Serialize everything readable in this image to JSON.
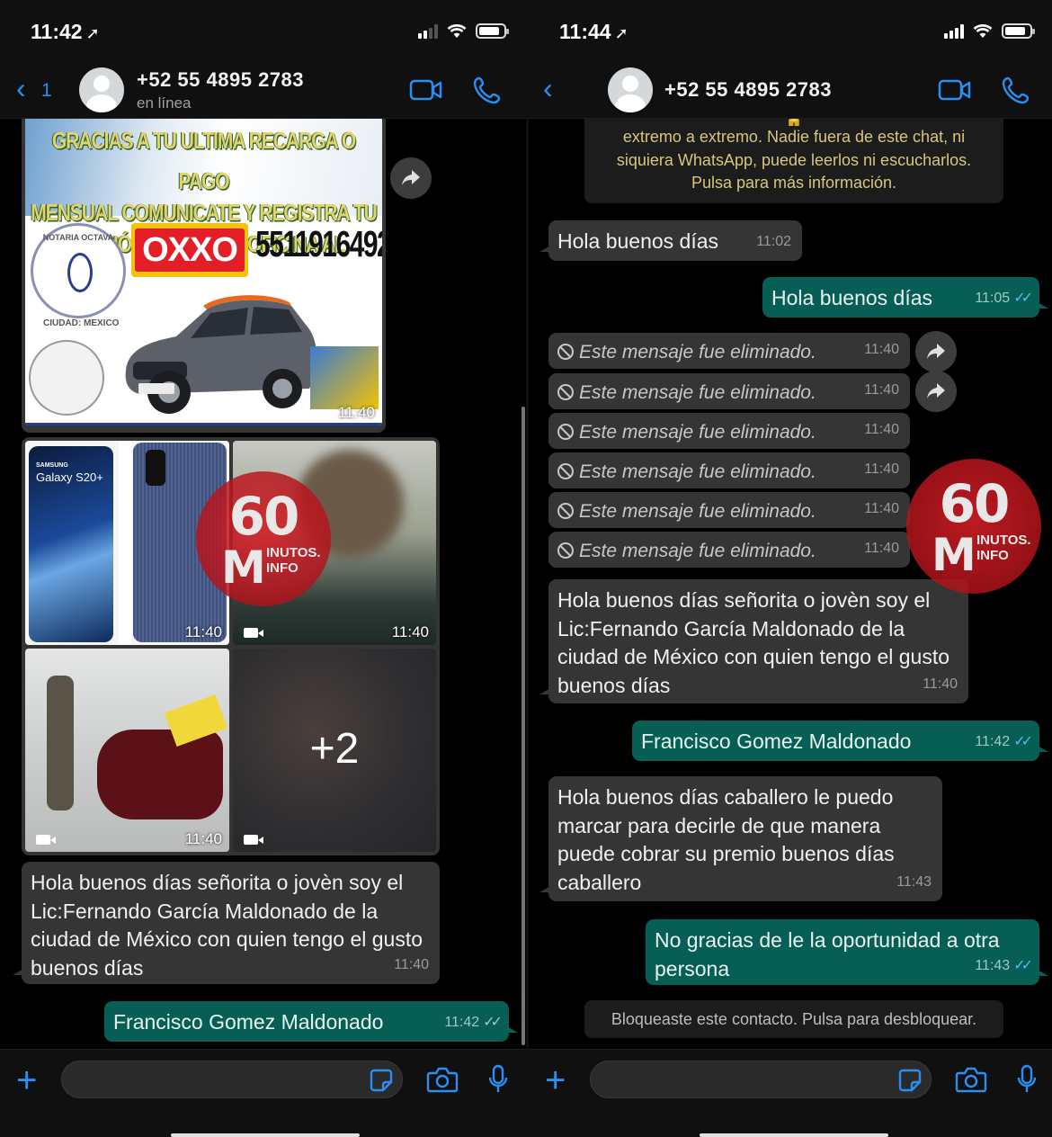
{
  "left": {
    "status": {
      "time": "11:42"
    },
    "header": {
      "back_count": "1",
      "contact_name": "+52 55 4895 2783",
      "contact_status": "en línea"
    },
    "promo_image": {
      "lines": [
        "GRACIAS A TU ULTIMA RECARGA O PAGO",
        "MENSUAL COMUNICATE Y REGISTRA TU",
        "PREMIÓ NÚMERO DE OFICINA AL"
      ],
      "brand": "OXXO",
      "phone": "5511916492",
      "seal_text": "NOTARIA OCTAVA",
      "seal_city": "CIUDAD: MEXICO",
      "time": "11:40"
    },
    "media": {
      "tile1": {
        "label_top": "SAMSUNG",
        "label": "Galaxy S20+",
        "time": "11:40"
      },
      "tile2": {
        "time": "11:40"
      },
      "tile3": {
        "time": "11:40"
      },
      "tile4": {
        "more": "+2"
      }
    },
    "messages": [
      {
        "text": "Hola buenos días señorita o jovèn soy el Lic:Fernando García Maldonado de la ciudad de México con quien tengo el gusto buenos días",
        "time": "11:40"
      },
      {
        "text": "Francisco Gomez Maldonado",
        "time": "11:42"
      }
    ]
  },
  "right": {
    "status": {
      "time": "11:44"
    },
    "header": {
      "contact_name": "+52 55 4895 2783"
    },
    "encryption_notice": "Los mensajes y las llamadas están cifrados de extremo a extremo. Nadie fuera de este chat, ni siquiera WhatsApp, puede leerlos ni escucharlos. Pulsa para más información.",
    "encryption_lines": [
      "extremo a extremo. Nadie fuera de este chat, ni",
      "siquiera WhatsApp, puede leerlos ni escucharlos.",
      "Pulsa para más información."
    ],
    "messages": {
      "m1": {
        "text": "Hola buenos días",
        "time": "11:02"
      },
      "m2": {
        "text": "Hola buenos días",
        "time": "11:05"
      },
      "deleted_text": "Este mensaje fue eliminado.",
      "deleted_time": "11:40",
      "m3": {
        "text": "Hola buenos días señorita o jovèn soy el Lic:Fernando García Maldonado de la ciudad de México con quien tengo el gusto buenos días",
        "time": "11:40"
      },
      "m4": {
        "text": "Francisco Gomez Maldonado",
        "time": "11:42"
      },
      "m5": {
        "text": "Hola buenos días caballero le puedo marcar para decirle de que manera puede cobrar su premio buenos días caballero",
        "time": "11:43"
      },
      "m6": {
        "text": "No gracias de le la oportunidad a otra persona",
        "time": "11:43"
      }
    },
    "blocked_notice": "Bloqueaste este contacto. Pulsa para desbloquear."
  },
  "watermark": {
    "number": "60",
    "letter": "M",
    "text1": "INUTOS.",
    "text2": "INFO"
  },
  "colors": {
    "accent": "#2a8ef3",
    "incoming": "#353535",
    "outgoing": "#075e54",
    "read_ticks": "#53bdeb",
    "watermark": "#d71e26"
  },
  "icons": [
    "chevron-left-icon",
    "video-call-icon",
    "phone-call-icon",
    "forward-icon",
    "plus-icon",
    "sticker-icon",
    "camera-icon",
    "microphone-icon",
    "deleted-icon",
    "location-arrow-icon"
  ]
}
